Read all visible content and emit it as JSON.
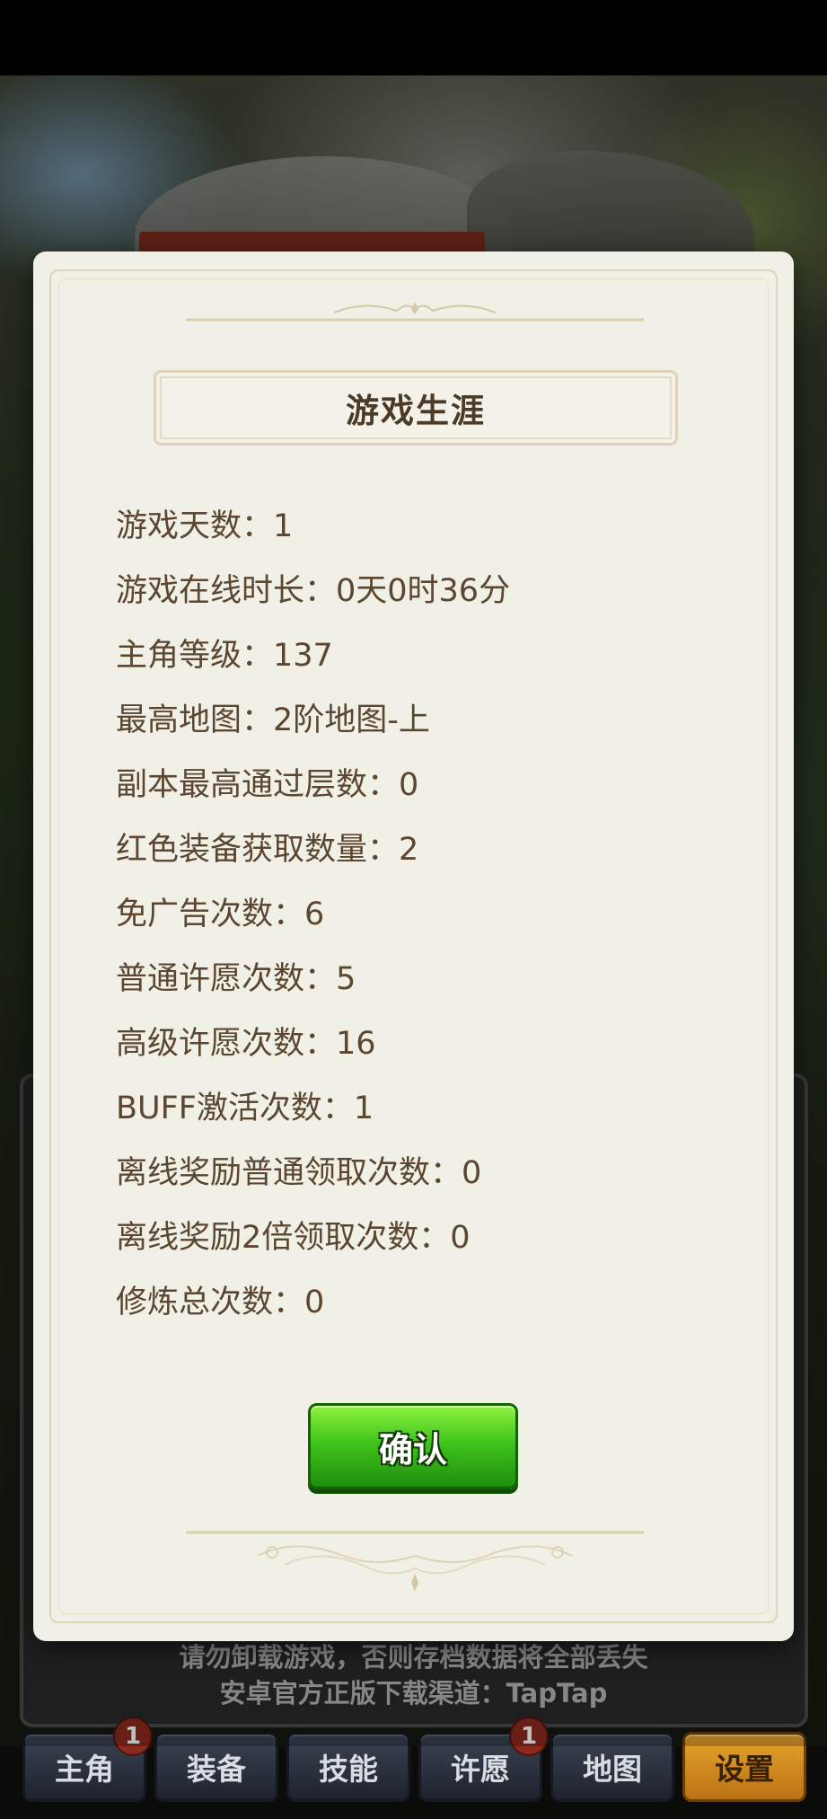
{
  "background": {
    "notice_line1": "请勿卸载游戏，否则存档数据将全部丢失",
    "notice_line2": "安卓官方正版下载渠道：TapTap",
    "tabs": [
      {
        "label": "主角",
        "badge": "1"
      },
      {
        "label": "装备"
      },
      {
        "label": "技能"
      },
      {
        "label": "许愿",
        "badge": "1"
      },
      {
        "label": "地图"
      },
      {
        "label": "设置",
        "active": true
      }
    ]
  },
  "dialog": {
    "title": "游戏生涯",
    "stats": [
      "游戏天数：1",
      "游戏在线时长：0天0时36分",
      "主角等级：137",
      "最高地图：2阶地图-上",
      "副本最高通过层数：0",
      "红色装备获取数量：2",
      "免广告次数：6",
      "普通许愿次数：5",
      "高级许愿次数：16",
      "BUFF激活次数：1",
      "离线奖励普通领取次数：0",
      "离线奖励2倍领取次数：0",
      "修炼总次数：0"
    ],
    "confirm_label": "确认"
  },
  "colors": {
    "dialog_bg": "#f1f0e6",
    "text": "#5a4631",
    "confirm_green": "#3fc41c",
    "tab_active": "#e6a52f"
  }
}
